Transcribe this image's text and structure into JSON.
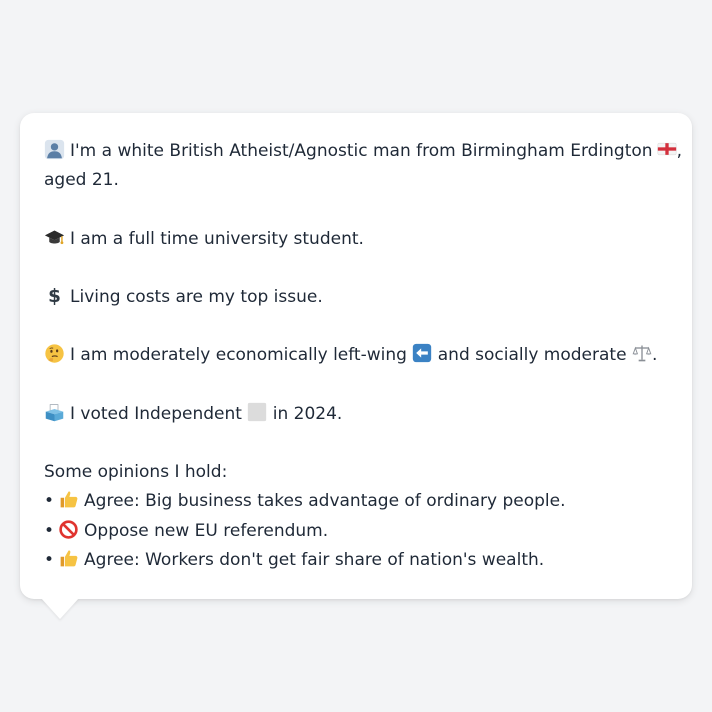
{
  "intro": {
    "icon": "person-silhouette-icon",
    "line1": "I'm a white British Atheist/Agnostic man from Birmingham Erdington",
    "flag_icon": "england-flag-icon",
    "line1_tail": ",",
    "line2": "aged 21."
  },
  "education": {
    "icon": "graduation-cap-icon",
    "text": "I am a full time university student."
  },
  "issue": {
    "icon": "dollar-sign-icon",
    "text": "Living costs are my top issue."
  },
  "politics": {
    "icon": "thinking-face-icon",
    "text_a": "I am moderately economically left-wing",
    "left_icon": "left-arrow-icon",
    "text_b": "and socially moderate",
    "scale_icon": "balance-scale-icon",
    "text_c": "."
  },
  "vote": {
    "icon": "ballot-box-icon",
    "text_a": "I voted Independent",
    "party_icon": "grey-square-icon",
    "text_b": "in 2024."
  },
  "opinions": {
    "heading": "Some opinions I hold:",
    "items": [
      {
        "bullet": "•",
        "icon": "thumbs-up-icon",
        "text": "Agree: Big business takes advantage of ordinary people."
      },
      {
        "bullet": "•",
        "icon": "no-entry-icon",
        "text": "Oppose new EU referendum."
      },
      {
        "bullet": "•",
        "icon": "thumbs-up-icon",
        "text": "Agree: Workers don't get fair share of nation's wealth."
      }
    ]
  },
  "colors": {
    "background": "#f3f4f6",
    "bubble": "#ffffff",
    "text": "#1f2937"
  }
}
